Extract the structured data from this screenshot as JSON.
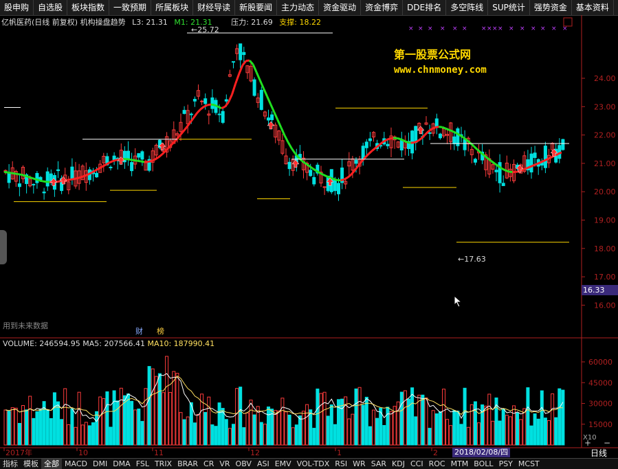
{
  "tabs": [
    "股申购",
    "自选股",
    "板块指数",
    "一致预期",
    "所属板块",
    "财经导读",
    "新股要闻",
    "主力动态",
    "资金驱动",
    "资金博弈",
    "DDE排名",
    "多空阵线",
    "SUP统计",
    "强势资金",
    "基本资料"
  ],
  "info": {
    "title": "亿帆医药(日线 前复权) 机构操盘趋势",
    "l3": "L3: 21.31",
    "m1": "M1: 21.31",
    "pressure": "压力: 21.69",
    "support": "支撑: 18.22"
  },
  "brand": {
    "name": "第一股票公式网",
    "url": "www.chnmoney.com"
  },
  "future_text": "用到未来数据",
  "labels": {
    "cai": "财",
    "bang": "榜"
  },
  "price_axis": [
    "24.00",
    "23.00",
    "22.00",
    "21.00",
    "20.00",
    "19.00",
    "18.00",
    "17.00",
    "16.00"
  ],
  "current_price": "16.33",
  "annotations": {
    "high": "25.72",
    "low": "17.63"
  },
  "volume": {
    "vol": "VOLUME: 246594.95",
    "ma5": "MA5: 207566.41",
    "ma10": "MA10: 187990.41",
    "axis": [
      "60000",
      "45000",
      "30000",
      "15000"
    ],
    "unit": "X10"
  },
  "time_axis": [
    "2017年",
    "10",
    "11",
    "12",
    "1",
    "2"
  ],
  "date_box": "2018/02/08/四",
  "period": "日线",
  "indicators": [
    "指标",
    "模板",
    "全部",
    "MACD",
    "DMI",
    "DMA",
    "FSL",
    "TRIX",
    "BRAR",
    "CR",
    "VR",
    "OBV",
    "ASI",
    "EMV",
    "VOL-TDX",
    "RSI",
    "WR",
    "SAR",
    "KDJ",
    "CCI",
    "ROC",
    "MTM",
    "BOLL",
    "PSY",
    "MCST"
  ],
  "colors": {
    "up": "#ff3c3c",
    "down": "#00e0e0",
    "trend_up": "#ff2020",
    "trend_down": "#20e020",
    "panel": "#3a2a7a"
  }
}
